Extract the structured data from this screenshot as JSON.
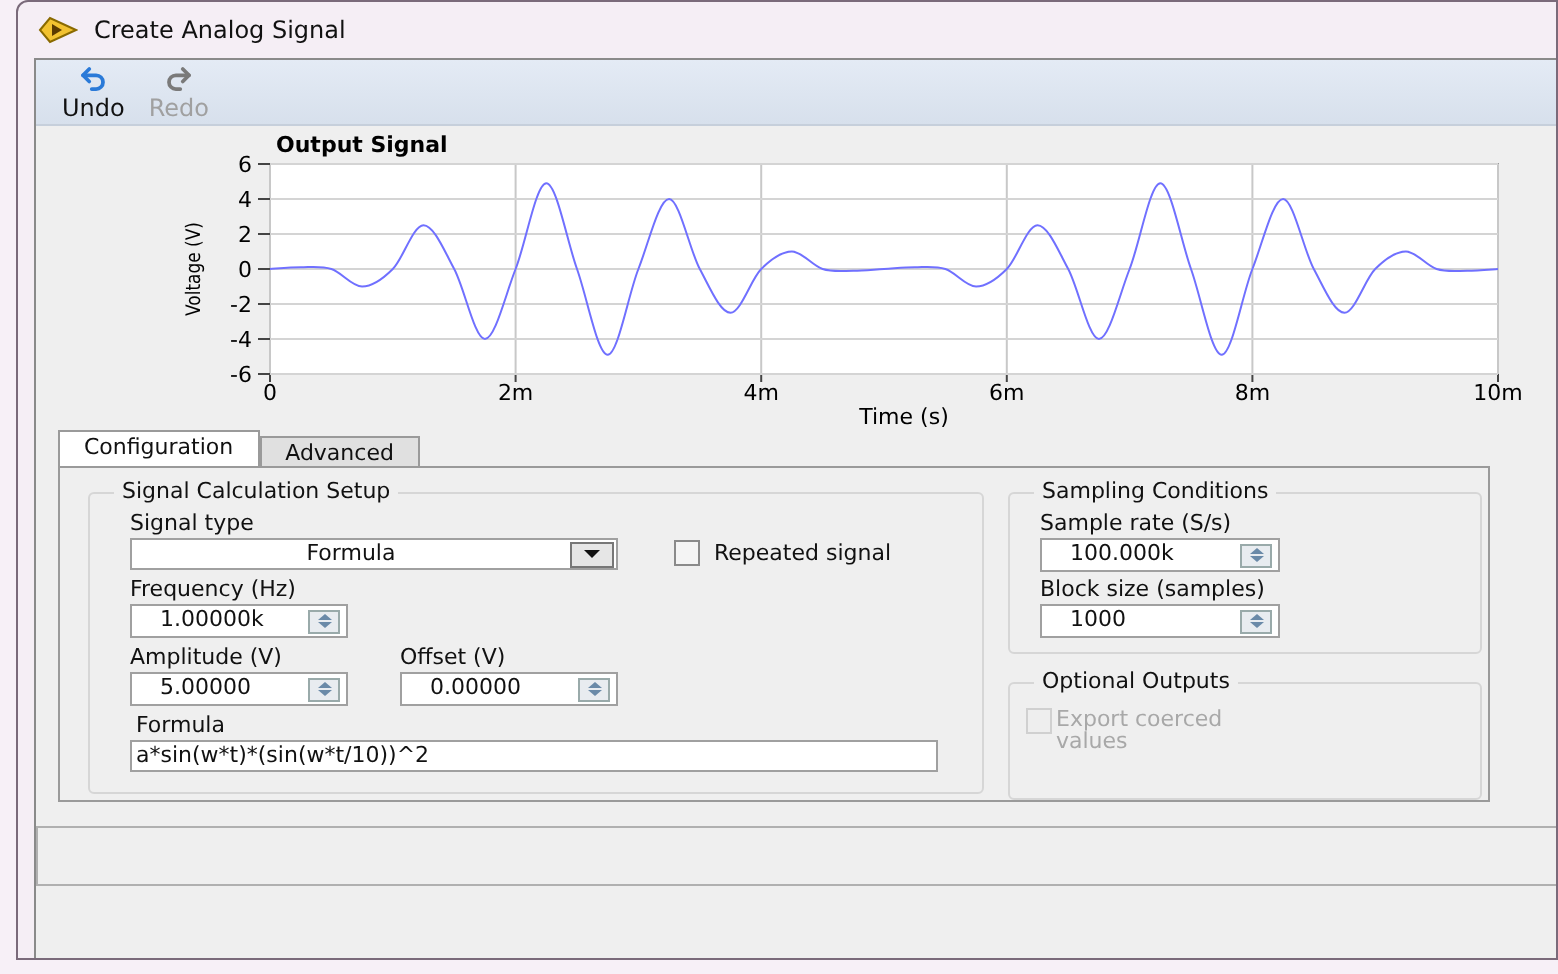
{
  "window": {
    "title": "Create Analog Signal"
  },
  "toolbar": [
    {
      "label": "Undo",
      "disabled": false
    },
    {
      "label": "Redo",
      "disabled": true
    }
  ],
  "graph": {
    "chart_data": {
      "type": "line",
      "title": "Output Signal",
      "xlabel": "Time (s)",
      "ylabel": "Voltage (V)",
      "xlim": [
        0,
        10
      ],
      "ylim": [
        -6,
        6
      ],
      "grid": true,
      "xticks": [
        {
          "value": 0,
          "label": "0"
        },
        {
          "value": 2,
          "label": "2m"
        },
        {
          "value": 4,
          "label": "4m"
        },
        {
          "value": 6,
          "label": "6m"
        },
        {
          "value": 8,
          "label": "8m"
        },
        {
          "value": 10,
          "label": "10m"
        }
      ],
      "yticks": [
        -6,
        -4,
        -2,
        0,
        2,
        4,
        6
      ],
      "x": [
        0,
        0.25,
        0.5,
        0.75,
        1,
        1.25,
        1.5,
        1.75,
        2,
        2.25,
        2.5,
        2.75,
        3,
        3.25,
        3.5,
        3.75,
        4,
        4.25,
        4.5,
        4.75,
        5,
        5.25,
        5.5,
        5.75,
        6,
        6.25,
        6.5,
        6.75,
        7,
        7.25,
        7.5,
        7.75,
        8,
        8.25,
        8.5,
        8.75,
        9,
        9.25,
        9.5,
        9.75,
        10
      ],
      "series": [
        {
          "color": "#7070ff",
          "values": [
            0,
            0.1,
            0,
            -1,
            0,
            2.5,
            0,
            -4,
            0,
            4.9,
            0,
            -4.9,
            0,
            4,
            0,
            -2.5,
            0,
            1,
            0,
            -0.1,
            0,
            0.1,
            0,
            -1,
            0,
            2.5,
            0,
            -4,
            0,
            4.9,
            0,
            -4.9,
            0,
            4,
            0,
            -2.5,
            0,
            1,
            0,
            -0.1,
            0
          ]
        }
      ]
    }
  },
  "tabs": [
    {
      "label": "Configuration",
      "selected": true
    },
    {
      "label": "Advanced",
      "selected": false
    }
  ],
  "signal_setup": {
    "title": "Signal Calculation Setup",
    "signal_type": {
      "label": "Signal type",
      "value": "Formula"
    },
    "repeated_signal": {
      "label": "Repeated signal",
      "checked": false
    },
    "frequency": {
      "label": "Frequency (Hz)",
      "value": "1.00000k"
    },
    "amplitude": {
      "label": "Amplitude (V)",
      "value": "5.00000"
    },
    "offset": {
      "label": "Offset (V)",
      "value": "0.00000"
    },
    "formula": {
      "label": "Formula",
      "value": "a*sin(w*t)*(sin(w*t/10))^2"
    }
  },
  "sampling": {
    "title": "Sampling Conditions",
    "sample_rate": {
      "label": "Sample rate (S/s)",
      "value": "100.000k"
    },
    "block_size": {
      "label": "Block size (samples)",
      "value": "1000"
    }
  },
  "optional_outputs": {
    "title": "Optional Outputs",
    "export_coerced": {
      "label": "Export coerced values",
      "checked": false,
      "disabled": true
    }
  }
}
